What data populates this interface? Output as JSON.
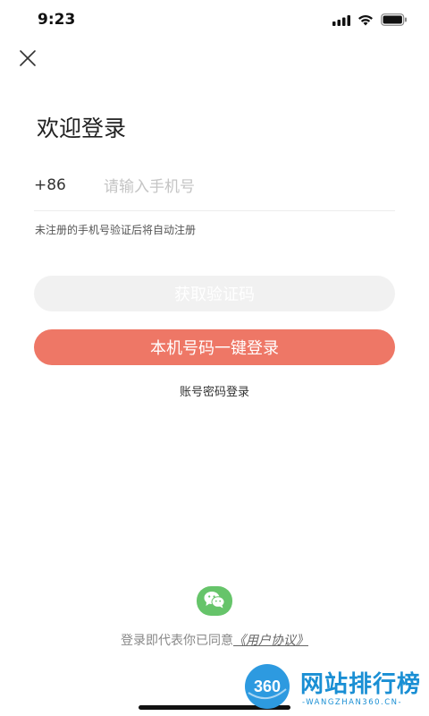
{
  "status_bar": {
    "time": "9:23"
  },
  "icons": {
    "close": "close-icon",
    "signal": "signal-icon",
    "wifi": "wifi-icon",
    "battery": "battery-icon",
    "wechat": "wechat-icon"
  },
  "login": {
    "title": "欢迎登录",
    "country_code": "+86",
    "phone_placeholder": "请输入手机号",
    "phone_value": "",
    "hint": "未注册的手机号验证后将自动注册",
    "get_code_label": "获取验证码",
    "one_key_login_label": "本机号码一键登录",
    "password_login_label": "账号密码登录"
  },
  "agreement": {
    "prefix": "登录即代表你已同意",
    "link": "《用户协议》"
  },
  "watermark": {
    "logo_text": "360",
    "title": "网站排行榜",
    "subtitle": "-WANGZHAN360.CN-"
  },
  "colors": {
    "primary_button": "#ee7766",
    "disabled_button": "#f1f1f1",
    "wechat_green": "#66c46a",
    "watermark_blue": "#1a8fd4"
  }
}
